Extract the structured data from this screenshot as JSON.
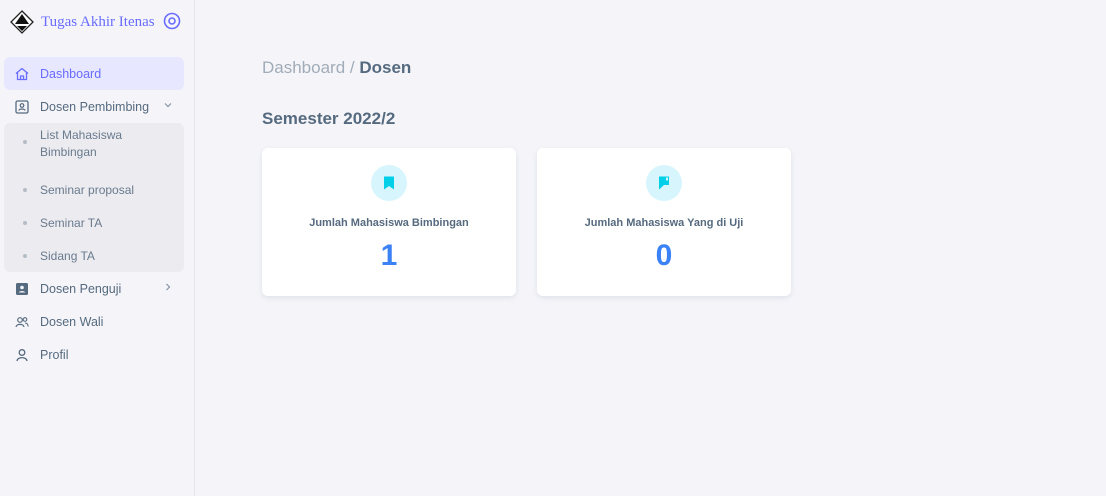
{
  "brand": {
    "name": "Tugas Akhir Itenas"
  },
  "menu": {
    "dashboard": "Dashboard",
    "dosen_pembimbing": {
      "label": "Dosen Pembimbing",
      "items": [
        "List Mahasiswa",
        "Bimbingan",
        "Seminar proposal",
        "Seminar TA",
        "Sidang TA"
      ]
    },
    "dosen_penguji": "Dosen Penguji",
    "dosen_wali": "Dosen Wali",
    "profil": "Profil"
  },
  "breadcrumb": {
    "parent": "Dashboard /",
    "current": "Dosen"
  },
  "semester": "Semester 2022/2",
  "cards": [
    {
      "title": "Jumlah Mahasiswa Bimbingan",
      "value": "1",
      "icon": "bookmark-icon"
    },
    {
      "title": "Jumlah Mahasiswa Yang di Uji",
      "value": "0",
      "icon": "flag-icon"
    }
  ],
  "colors": {
    "accent": "#696cff",
    "value": "#3b82f6",
    "icon": "#00cfe8",
    "active_bg": "#e7e7ff"
  }
}
